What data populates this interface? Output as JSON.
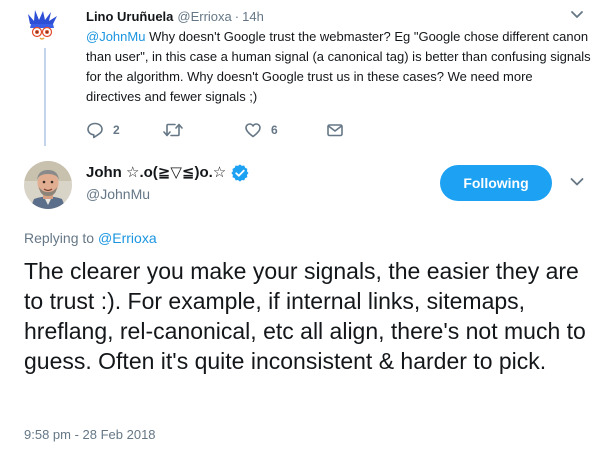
{
  "parent_tweet": {
    "author_name": "Lino Uruñuela",
    "handle": "@Errioxa",
    "separator": "·",
    "time_ago": "14h",
    "mention": "@JohnMu",
    "text": " Why doesn't Google trust the webmaster? Eg \"Google chose different canon than user\", in this case a human signal (a canonical tag) is better than confusing signals for the algorithm. Why doesn't Google trust us in these cases? We need more directives and fewer signals ;)",
    "actions": {
      "reply_icon": "reply-icon",
      "reply_count": "2",
      "retweet_icon": "retweet-icon",
      "like_icon": "heart-icon",
      "like_count": "6",
      "dm_icon": "envelope-icon"
    }
  },
  "main_tweet": {
    "author_name": "John ☆.o(≧▽≦)o.☆",
    "handle": "@JohnMu",
    "follow_button": "Following",
    "replying_label": "Replying to",
    "replying_to": "@Errioxa",
    "text": "The clearer you make your signals, the easier they are to trust :). For example, if internal links, sitemaps, hreflang, rel-canonical, etc all align, there's not much to guess. Often it's quite inconsistent & harder to pick.",
    "timestamp": "9:58 pm - 28 Feb 2018"
  },
  "colors": {
    "accent": "#1da1f2",
    "link": "#1b95e0",
    "secondary_text": "#657786",
    "thread_line": "#c3d3ec"
  }
}
